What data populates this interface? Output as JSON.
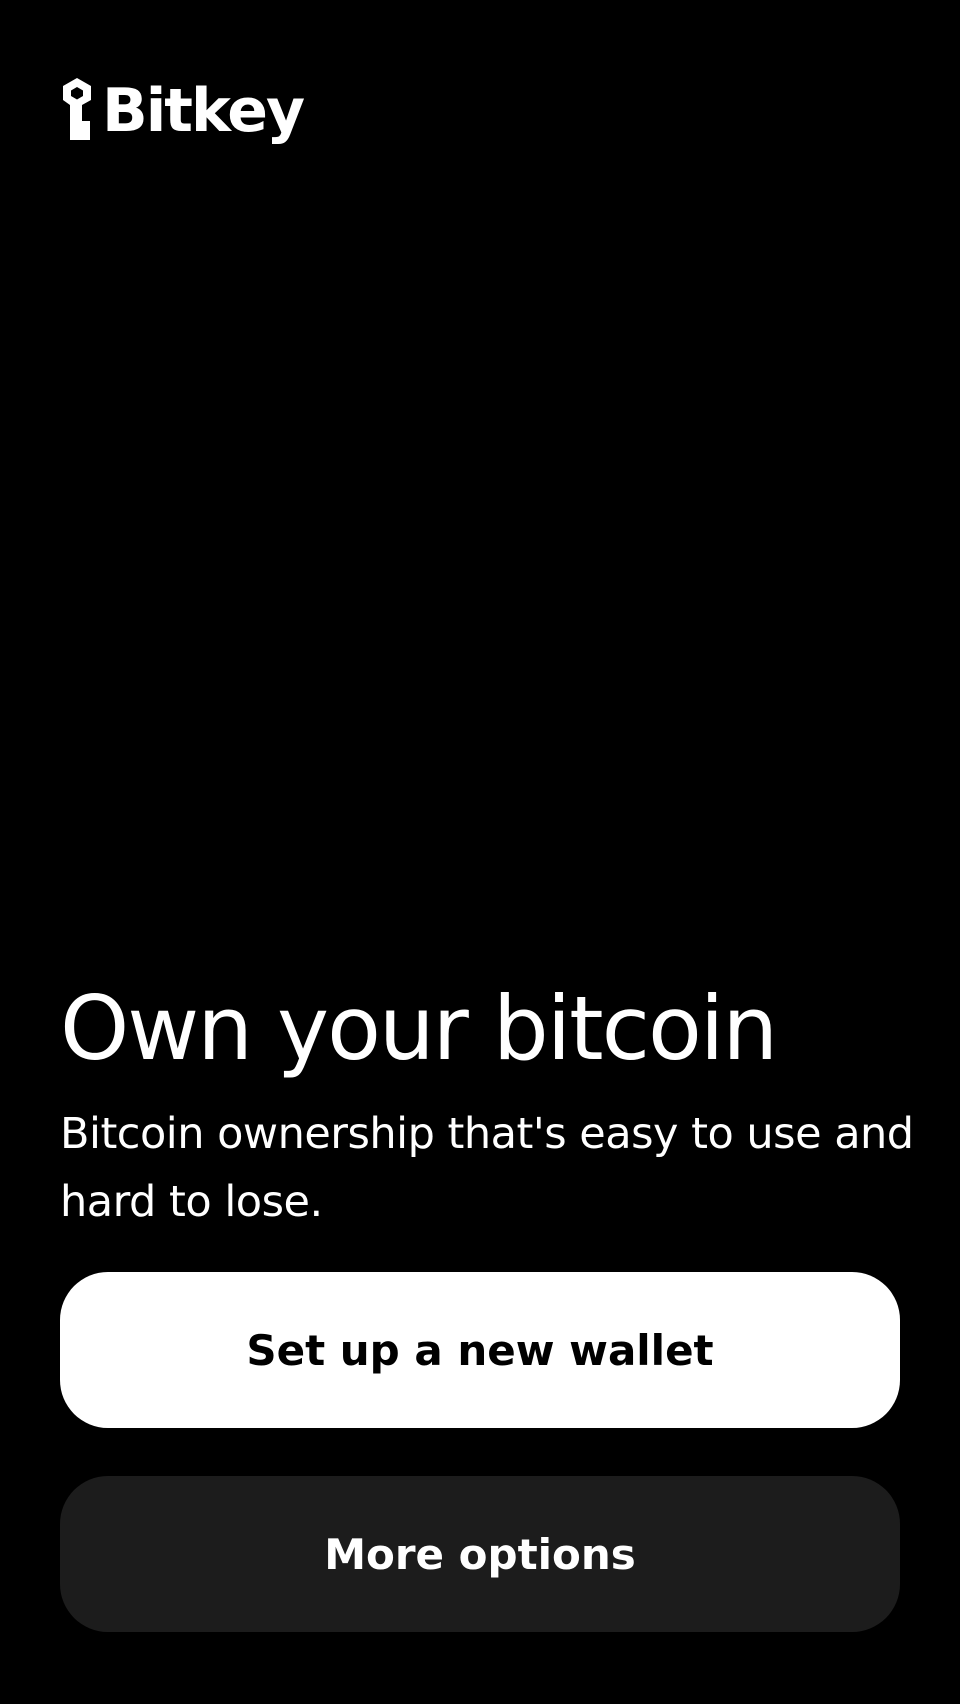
{
  "brand": {
    "logo_icon": "key-icon",
    "name": "Bitkey"
  },
  "hero": {
    "title": "Own your bitcoin",
    "subtitle": "Bitcoin ownership that's easy to use and hard to lose."
  },
  "actions": {
    "primary_label": "Set up a new wallet",
    "secondary_label": "More options"
  },
  "colors": {
    "background": "#000000",
    "primary_button": "#ffffff",
    "secondary_button": "#1c1c1c",
    "text": "#ffffff"
  }
}
